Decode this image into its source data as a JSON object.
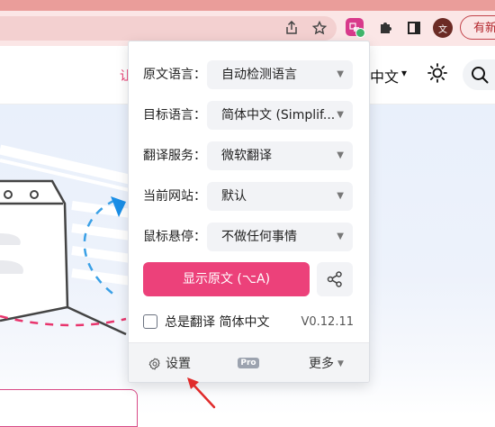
{
  "browser": {
    "avatar_letter": "文",
    "update_button_label": "有新",
    "icons": [
      "share-icon",
      "bookmark-star-icon",
      "translate-extension-icon",
      "puzzle-extensions-icon",
      "sidepanel-icon"
    ]
  },
  "site": {
    "nav_fragment": "让",
    "language_label": "中文",
    "language_caret": "▾",
    "accent_color": "#e8356d"
  },
  "popup": {
    "rows": [
      {
        "label": "原文语言：",
        "value": "自动检测语言"
      },
      {
        "label": "目标语言：",
        "value": "简体中文 (Simplif..."
      },
      {
        "label": "翻译服务：",
        "value": "微软翻译"
      },
      {
        "label": "当前网站：",
        "value": "默认"
      },
      {
        "label": "鼠标悬停：",
        "value": "不做任何事情"
      }
    ],
    "caret": "▼",
    "primary_button": "显示原文 (⌥A)",
    "primary_color": "#ec417a",
    "always_translate_label": "总是翻译 简体中文",
    "always_translate_checked": false,
    "version": "V0.12.11",
    "footer": {
      "settings_label": "设置",
      "pro_badge": "Pro",
      "more_label": "更多",
      "more_caret": "▼"
    }
  }
}
